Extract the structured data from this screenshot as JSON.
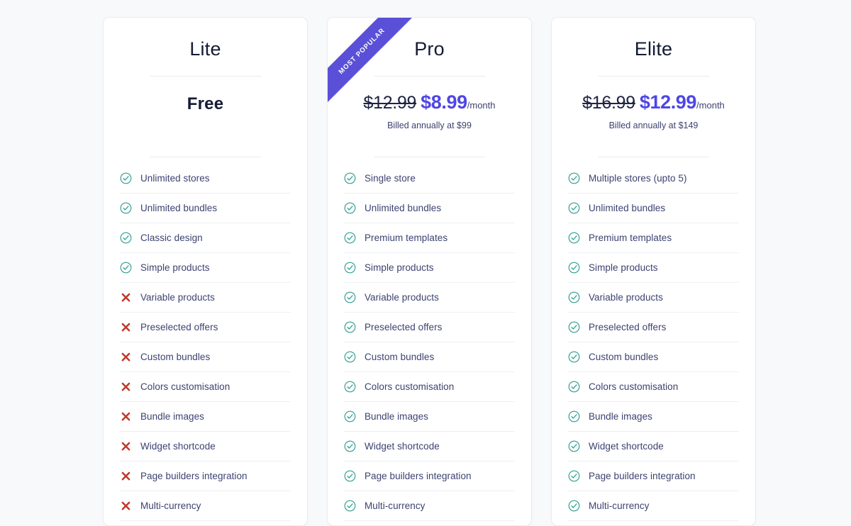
{
  "theme": {
    "page_background": "#f8f9fa",
    "card_background": "#ffffff",
    "accent": "#4f46e5",
    "ribbon": "#5a50d8",
    "check_color": "#2f9e8f",
    "cross_color": "#c0392b",
    "text_primary": "#141b34",
    "text_body": "#3c4270"
  },
  "plans": [
    {
      "name": "Lite",
      "badge": null,
      "price_old": null,
      "price_new": null,
      "price_free": "Free",
      "period": null,
      "billed": null,
      "features": [
        {
          "label": "Unlimited stores",
          "included": true
        },
        {
          "label": "Unlimited bundles",
          "included": true
        },
        {
          "label": "Classic design",
          "included": true
        },
        {
          "label": "Simple products",
          "included": true
        },
        {
          "label": "Variable products",
          "included": false
        },
        {
          "label": "Preselected offers",
          "included": false
        },
        {
          "label": "Custom bundles",
          "included": false
        },
        {
          "label": "Colors customisation",
          "included": false
        },
        {
          "label": "Bundle images",
          "included": false
        },
        {
          "label": "Widget shortcode",
          "included": false
        },
        {
          "label": "Page builders integration",
          "included": false
        },
        {
          "label": "Multi-currency",
          "included": false
        }
      ]
    },
    {
      "name": "Pro",
      "badge": "Most popular",
      "price_old": "$12.99",
      "price_new": "$8.99",
      "price_free": null,
      "period": "/month",
      "billed": "Billed annually at $99",
      "features": [
        {
          "label": "Single store",
          "included": true
        },
        {
          "label": "Unlimited bundles",
          "included": true
        },
        {
          "label": "Premium templates",
          "included": true
        },
        {
          "label": "Simple products",
          "included": true
        },
        {
          "label": "Variable products",
          "included": true
        },
        {
          "label": "Preselected offers",
          "included": true
        },
        {
          "label": "Custom bundles",
          "included": true
        },
        {
          "label": "Colors customisation",
          "included": true
        },
        {
          "label": "Bundle images",
          "included": true
        },
        {
          "label": "Widget shortcode",
          "included": true
        },
        {
          "label": "Page builders integration",
          "included": true
        },
        {
          "label": "Multi-currency",
          "included": true
        }
      ]
    },
    {
      "name": "Elite",
      "badge": null,
      "price_old": "$16.99",
      "price_new": "$12.99",
      "price_free": null,
      "period": "/month",
      "billed": "Billed annually at $149",
      "features": [
        {
          "label": "Multiple stores (upto 5)",
          "included": true
        },
        {
          "label": "Unlimited bundles",
          "included": true
        },
        {
          "label": "Premium templates",
          "included": true
        },
        {
          "label": "Simple products",
          "included": true
        },
        {
          "label": "Variable products",
          "included": true
        },
        {
          "label": "Preselected offers",
          "included": true
        },
        {
          "label": "Custom bundles",
          "included": true
        },
        {
          "label": "Colors customisation",
          "included": true
        },
        {
          "label": "Bundle images",
          "included": true
        },
        {
          "label": "Widget shortcode",
          "included": true
        },
        {
          "label": "Page builders integration",
          "included": true
        },
        {
          "label": "Multi-currency",
          "included": true
        }
      ]
    }
  ],
  "icons": {
    "check": "check-circle-icon",
    "cross": "cross-icon"
  }
}
